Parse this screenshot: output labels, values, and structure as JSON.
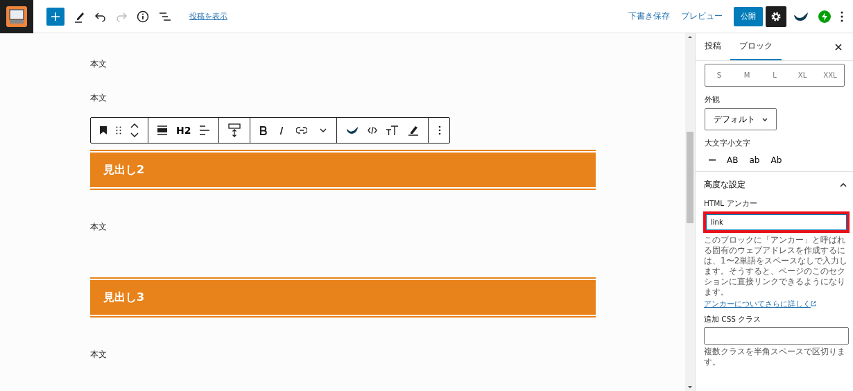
{
  "top_bar": {
    "view_post": "投稿を表示",
    "save_draft": "下書き保存",
    "preview": "プレビュー",
    "publish": "公開",
    "settings_active": true
  },
  "content": [
    {
      "kind": "paragraph",
      "text": "本文"
    },
    {
      "kind": "paragraph",
      "text": "本文"
    },
    {
      "kind": "toolbar",
      "heading_level": "H2"
    },
    {
      "kind": "heading",
      "text": "見出し2"
    },
    {
      "kind": "paragraph",
      "text": "本文"
    },
    {
      "kind": "spacer"
    },
    {
      "kind": "heading",
      "text": "見出し3"
    },
    {
      "kind": "paragraph",
      "text": "本文"
    }
  ],
  "sidebar": {
    "tabs": [
      {
        "label": "投稿",
        "selected": false
      },
      {
        "label": "ブロック",
        "selected": true
      }
    ],
    "font_sizes": [
      {
        "label": "S",
        "selected": false
      },
      {
        "label": "M",
        "selected": false
      },
      {
        "label": "L",
        "selected": false
      },
      {
        "label": "XL",
        "selected": false
      },
      {
        "label": "XXL",
        "selected": false
      }
    ],
    "appearance": {
      "label": "外観",
      "value": "デフォルト"
    },
    "letter_case": {
      "label": "大文字小文字",
      "options": [
        {
          "kind": "none"
        },
        {
          "kind": "text",
          "label": "AB"
        },
        {
          "kind": "text",
          "label": "ab"
        },
        {
          "kind": "text",
          "label": "Ab"
        }
      ]
    },
    "advanced": {
      "title": "高度な設定",
      "expanded": true,
      "anchor": {
        "label": "HTML アンカー",
        "value": "link",
        "highlighted": true
      },
      "help": "このブロックに「アンカー」と呼ばれる固有のウェブアドレスを作成するには、1〜2単語をスペースなしで入力します。そうすると、ページのこのセクションに直接リンクできるようになります。",
      "learn_more": "アンカーについてさらに詳しく",
      "css_class": {
        "label": "追加 CSS クラス"
      },
      "css_help": "複数クラスを半角スペースで区切ります。"
    }
  }
}
